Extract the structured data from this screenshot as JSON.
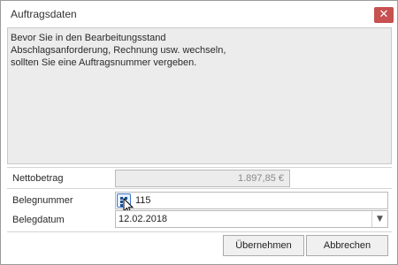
{
  "window": {
    "title": "Auftragsdaten",
    "close_symbol": "✕"
  },
  "info": {
    "lines": [
      "Bevor Sie in den Bearbeitungsstand",
      "Abschlagsanforderung, Rechnung usw. wechseln,",
      "sollten Sie eine Auftragsnummer vergeben."
    ]
  },
  "fields": {
    "nettobetrag": {
      "label": "Nettobetrag",
      "value": "1.897,85 €"
    },
    "belegnummer": {
      "label": "Belegnummer",
      "value": "115",
      "icon": "number-sequence-icon"
    },
    "belegdatum": {
      "label": "Belegdatum",
      "value": "12.02.2018",
      "dropdown_icon": "chevron-down-icon"
    }
  },
  "buttons": {
    "apply": "Übernehmen",
    "cancel": "Abbrechen"
  },
  "colors": {
    "close_button": "#c75050",
    "panel_bg": "#ececec",
    "icon_accent": "#3b78c9"
  }
}
